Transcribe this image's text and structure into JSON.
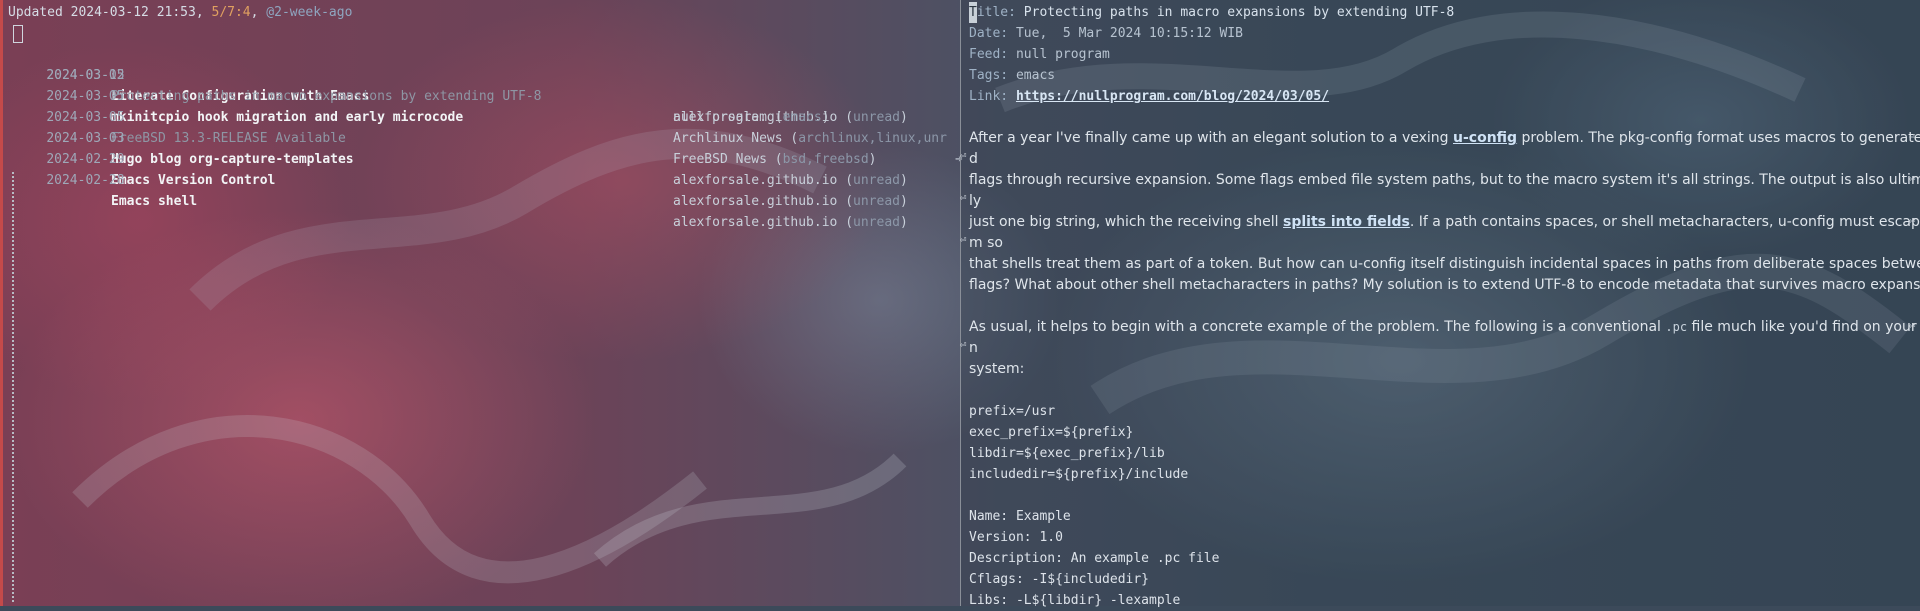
{
  "left_pane": {
    "header": {
      "prefix": "Updated 2024-03-12 21:53, ",
      "count": "5/7:4",
      "sep": ", ",
      "relative": "@2-week-ago"
    },
    "entries": [
      {
        "date": "2024-03-12",
        "title": "Literate Configuration with Emacs",
        "feed": "alexforsale.github.io",
        "tags": "unread",
        "state": "unread"
      },
      {
        "date": "2024-03-05",
        "title": "Protecting paths in macro expansions by extending UTF-8",
        "feed": "null program",
        "tags": "emacs",
        "state": "read"
      },
      {
        "date": "2024-03-05",
        "title": "mkinitcpio hook migration and early microcode",
        "feed": "Archlinux News",
        "tags": "archlinux,linux,unr",
        "state": "unread"
      },
      {
        "date": "2024-03-05",
        "title": "FreeBSD 13.3-RELEASE Available",
        "feed": "FreeBSD News",
        "tags": "bsd,freebsd",
        "state": "read"
      },
      {
        "date": "2024-03-03",
        "title": "Hugo blog org-capture-templates",
        "feed": "alexforsale.github.io",
        "tags": "unread",
        "state": "unread"
      },
      {
        "date": "2024-02-29",
        "title": "Emacs Version Control",
        "feed": "alexforsale.github.io",
        "tags": "unread",
        "state": "unread"
      },
      {
        "date": "2024-02-28",
        "title": "Emacs shell",
        "feed": "alexforsale.github.io",
        "tags": "unread",
        "state": "unread"
      }
    ],
    "truncation_mark": "➔"
  },
  "right_pane": {
    "meta": {
      "title_key": "Title:",
      "title_first": "T",
      "title_rest": "itle:",
      "title_value": "Protecting paths in macro expansions by extending UTF-8",
      "date_key": "Date:",
      "date_value": "Tue,  5 Mar 2024 10:15:12 WIB",
      "feed_key": "Feed:",
      "feed_value": "null program",
      "tags_key": "Tags:",
      "tags_value": "emacs",
      "link_key": "Link:",
      "link_value": "https://nullprogram.com/blog/2024/03/05/"
    },
    "paragraph1": {
      "l1a": "After a year I've finally came up with an elegant solution to a vexing ",
      "l1_link": "u-config",
      "l1b": " problem. The pkg-config format uses macros to generate buil",
      "l2": "d",
      "l3": "flags through recursive expansion. Some flags embed file system paths, but to the macro system it's all strings. The output is also ultimate",
      "l4": "ly",
      "l5a": "just one big string, which the receiving shell ",
      "l5_link": "splits into fields",
      "l5b": ". If a path contains spaces, or shell metacharacters, u-config must escape the",
      "l6": "m so",
      "l7": "that shells treat them as part of a token. But how can u-config itself distinguish incidental spaces in paths from deliberate spaces between",
      "l8": "flags? What about other shell metacharacters in paths? My solution is to extend UTF-8 to encode metadata that survives macro expansion."
    },
    "paragraph2": {
      "l1a": "As usual, it helps to begin with a concrete example of the problem. The following is a conventional ",
      "l1_code": ".pc",
      "l1b": " file much like you'd find on your ow",
      "l2": "n",
      "l3": "system:"
    },
    "code_block": [
      "prefix=/usr",
      "exec_prefix=${prefix}",
      "libdir=${exec_prefix}/lib",
      "includedir=${prefix}/include",
      "",
      "Name: Example",
      "Version: 1.0",
      "Description: An example .pc file",
      "Cflags: -I${includedir}",
      "Libs: -L${libdir} -lexample"
    ],
    "wrap_mark": "⏎"
  }
}
